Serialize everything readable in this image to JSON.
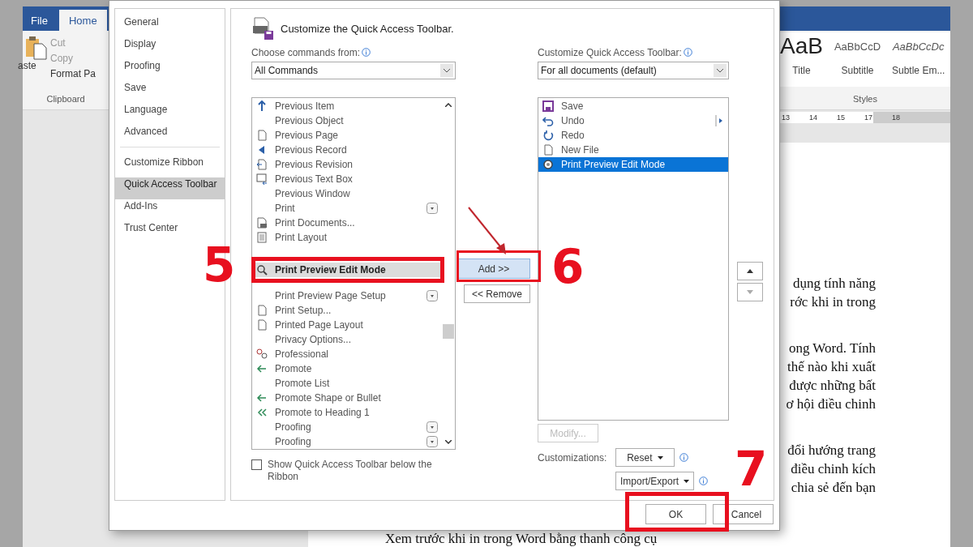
{
  "word": {
    "tabs": [
      {
        "label": "File",
        "selected": false
      },
      {
        "label": "Home",
        "selected": true
      }
    ],
    "clipboard": {
      "paste": "aste",
      "cut": "Cut",
      "copy": "Copy",
      "format_painter": "Format Pa",
      "group": "Clipboard"
    },
    "styles": {
      "items": [
        {
          "sample": "AaB",
          "name": "Title",
          "kind": "title"
        },
        {
          "sample": "AaBbCcD",
          "name": "Subtitle",
          "kind": "subtitle"
        },
        {
          "sample": "AaBbCcDc",
          "name": "Subtle Em...",
          "kind": "emphasis"
        }
      ],
      "group": "Styles"
    },
    "ruler": [
      "13",
      "14",
      "15",
      "17",
      "18"
    ],
    "document": {
      "paragraphs": [
        [
          "dụng tính năng",
          "rớc khi in trong"
        ],
        [
          "ong Word. Tính",
          "thế nào khi xuất",
          "được những bất",
          "ơ hội điều chinh"
        ],
        [
          "đổi hướng trang",
          "điều chinh kích",
          "chia sẻ đến bạn"
        ]
      ],
      "caption": "Xem trước khi in trong Word bằng thanh công cụ"
    }
  },
  "dialog": {
    "nav": [
      {
        "label": "General",
        "selected": false
      },
      {
        "label": "Display",
        "selected": false
      },
      {
        "label": "Proofing",
        "selected": false
      },
      {
        "label": "Save",
        "selected": false
      },
      {
        "label": "Language",
        "selected": false
      },
      {
        "label": "Advanced",
        "selected": false
      },
      {
        "label": "Customize Ribbon",
        "selected": false
      },
      {
        "label": "Quick Access Toolbar",
        "selected": true
      },
      {
        "label": "Add-Ins",
        "selected": false
      },
      {
        "label": "Trust Center",
        "selected": false
      }
    ],
    "heading": "Customize the Quick Access Toolbar.",
    "choose_label": "Choose commands from:",
    "choose_value": "All Commands",
    "commands": [
      {
        "label": "Previous Item",
        "selected": false,
        "has_menu": false,
        "covered": false
      },
      {
        "label": "Previous Object",
        "selected": false,
        "has_menu": false,
        "covered": false
      },
      {
        "label": "Previous Page",
        "selected": false,
        "has_menu": false,
        "covered": false
      },
      {
        "label": "Previous Record",
        "selected": false,
        "has_menu": false,
        "covered": false
      },
      {
        "label": "Previous Revision",
        "selected": false,
        "has_menu": false,
        "covered": false
      },
      {
        "label": "Previous Text Box",
        "selected": false,
        "has_menu": false,
        "covered": false
      },
      {
        "label": "Previous Window",
        "selected": false,
        "has_menu": false,
        "covered": false
      },
      {
        "label": "Print",
        "selected": false,
        "has_menu": true,
        "covered": false
      },
      {
        "label": "Print Documents...",
        "selected": false,
        "has_menu": false,
        "covered": false
      },
      {
        "label": "Print Layout",
        "selected": false,
        "has_menu": false,
        "covered": false
      },
      {
        "label": "Print Preview Edit Mode",
        "selected": true,
        "has_menu": false,
        "covered": false
      },
      {
        "label": "Print Preview Page Setup",
        "selected": false,
        "has_menu": true,
        "covered": false
      },
      {
        "label": "Print Setup...",
        "selected": false,
        "has_menu": false,
        "covered": false
      },
      {
        "label": "Printed Page Layout",
        "selected": false,
        "has_menu": false,
        "covered": false
      },
      {
        "label": "Privacy Options...",
        "selected": false,
        "has_menu": false,
        "covered": false
      },
      {
        "label": "Professional",
        "selected": false,
        "has_menu": false,
        "covered": false
      },
      {
        "label": "Promote",
        "selected": false,
        "has_menu": false,
        "covered": false
      },
      {
        "label": "Promote List",
        "selected": false,
        "has_menu": false,
        "covered": false
      },
      {
        "label": "Promote Shape or Bullet",
        "selected": false,
        "has_menu": false,
        "covered": false
      },
      {
        "label": "Promote to Heading 1",
        "selected": false,
        "has_menu": false,
        "covered": false
      },
      {
        "label": "Proofing",
        "selected": false,
        "has_menu": true,
        "covered": false
      },
      {
        "label": "Proofing",
        "selected": false,
        "has_menu": true,
        "covered": false
      }
    ],
    "add_button": {
      "label": "Add >>",
      "highlighted": true
    },
    "remove_button": "<< Remove",
    "toolbar_label": "Customize Quick Access Toolbar:",
    "toolbar_value": "For all documents (default)",
    "toolbar_items": [
      {
        "label": "Save",
        "selected": false,
        "has_menu": false
      },
      {
        "label": "Undo",
        "selected": false,
        "has_menu": true
      },
      {
        "label": "Redo",
        "selected": false,
        "has_menu": false
      },
      {
        "label": "New File",
        "selected": false,
        "has_menu": false
      },
      {
        "label": "Print Preview Edit Mode",
        "selected": true,
        "has_menu": false
      }
    ],
    "modify_button": {
      "label": "Modify...",
      "disabled": true
    },
    "customizations_label": "Customizations:",
    "reset_button": "Reset",
    "import_export_button": "Import/Export",
    "show_below": {
      "label": "Show Quick Access Toolbar below the Ribbon",
      "checked": false
    },
    "ok_button": "OK",
    "cancel_button": "Cancel"
  },
  "annotations": [
    {
      "label": "5"
    },
    {
      "label": "6"
    },
    {
      "label": "7"
    }
  ]
}
